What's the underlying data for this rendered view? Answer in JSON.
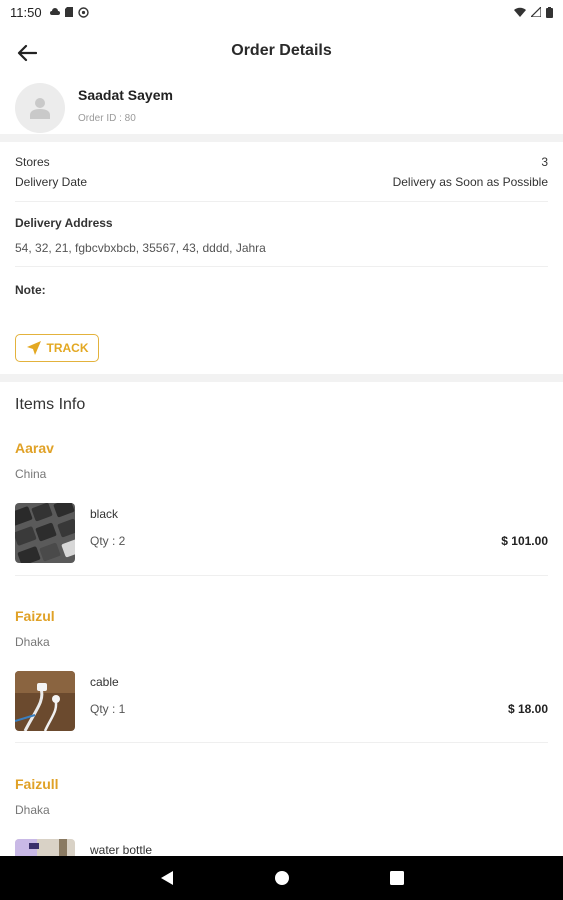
{
  "status_bar": {
    "time": "11:50"
  },
  "app_bar": {
    "title": "Order Details"
  },
  "customer": {
    "name": "Saadat Sayem",
    "order_id_text": "Order ID : 80"
  },
  "summary": {
    "stores_label": "Stores",
    "stores_value": "3",
    "delivery_date_label": "Delivery Date",
    "delivery_date_value": "Delivery as Soon as Possible",
    "address_label": "Delivery Address",
    "address_value": "54, 32, 21, fgbcvbxbcb, 35567, 43, dddd, Jahra",
    "note_label": "Note:",
    "track_label": "TRACK"
  },
  "items_info": {
    "title": "Items Info",
    "groups": [
      {
        "store": "Aarav",
        "location": "China",
        "item": "black",
        "qty": "Qty : 2",
        "price": "$ 101.00"
      },
      {
        "store": "Faizul",
        "location": "Dhaka",
        "item": "cable",
        "qty": "Qty : 1",
        "price": "$ 18.00"
      },
      {
        "store": "Faizull",
        "location": "Dhaka",
        "item": "water bottle"
      }
    ]
  },
  "colors": {
    "accent": "#e3a822",
    "divider": "#f2f2f2"
  },
  "icons": [
    "back-arrow-icon",
    "person-icon",
    "navigation-icon",
    "wifi-icon",
    "signal-icon",
    "battery-icon",
    "nav-back-icon",
    "nav-home-icon",
    "nav-recents-icon"
  ]
}
